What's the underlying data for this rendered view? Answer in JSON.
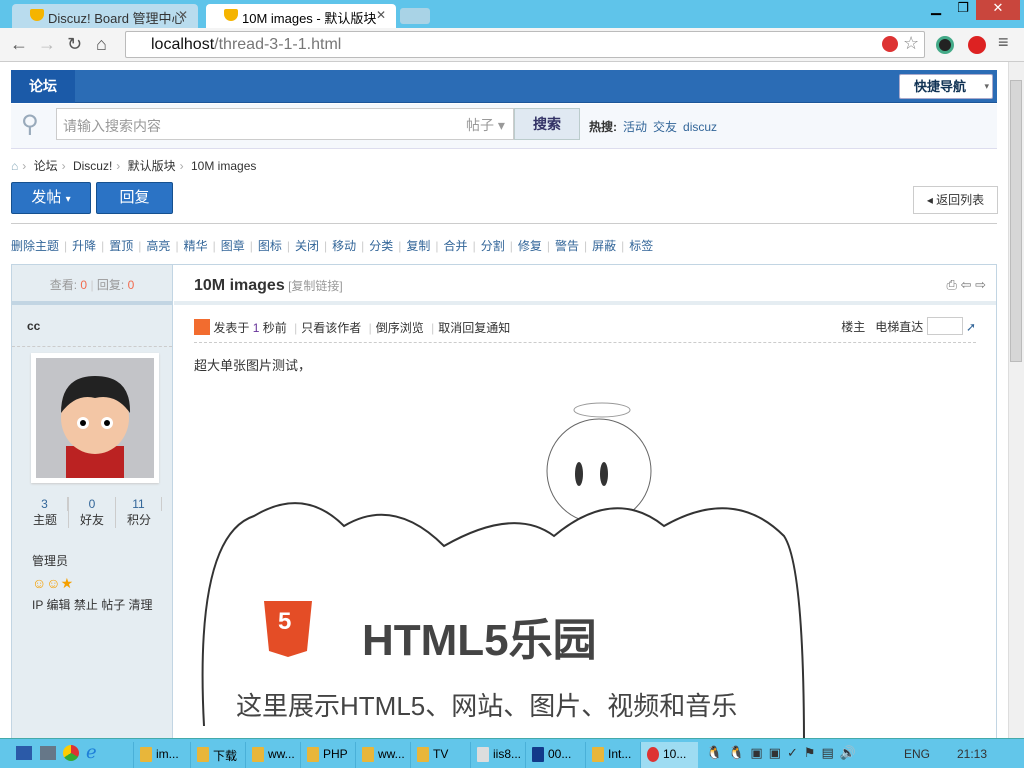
{
  "browser": {
    "tabs": [
      {
        "title": "Discuz! Board 管理中心",
        "active": false
      },
      {
        "title": "10M images - 默认版块",
        "active": true
      }
    ],
    "url_host": "localhost",
    "url_path": "/thread-3-1-1.html",
    "window_buttons": [
      "minimize",
      "restore",
      "close"
    ]
  },
  "nav": {
    "home": "论坛",
    "quick_nav": "快捷导航"
  },
  "search": {
    "placeholder": "请输入搜索内容",
    "type": "帖子",
    "button": "搜索",
    "hot_label": "热搜:",
    "hot": [
      "活动",
      "交友",
      "discuz"
    ]
  },
  "breadcrumb": [
    "论坛",
    "Discuz!",
    "默认版块",
    "10M images"
  ],
  "actions": {
    "post": "发帖",
    "reply": "回复",
    "back": "返回列表"
  },
  "mod_actions": [
    "删除主题",
    "升降",
    "置顶",
    "高亮",
    "精华",
    "图章",
    "图标",
    "关闭",
    "移动",
    "分类",
    "复制",
    "合并",
    "分割",
    "修复",
    "警告",
    "屏蔽",
    "标签"
  ],
  "thread": {
    "views_label": "查看:",
    "views": "0",
    "replies_label": "回复:",
    "replies": "0",
    "title": "10M images",
    "copy_link": "[复制链接]"
  },
  "author": {
    "name": "cc",
    "counts": [
      {
        "value": "3",
        "label": "主题"
      },
      {
        "value": "0",
        "label": "好友"
      },
      {
        "value": "11",
        "label": "积分"
      }
    ],
    "group": "管理员",
    "admin_links": [
      "IP",
      "编辑",
      "禁止",
      "帖子",
      "清理"
    ]
  },
  "post": {
    "posted_prefix": "发表于",
    "posted_num": "1",
    "posted_suffix": "秒前",
    "links": [
      "只看该作者",
      "倒序浏览",
      "取消回复通知"
    ],
    "floor": "楼主",
    "jump": "电梯直达",
    "text": "超大单张图片测试，",
    "image_title": "HTML5乐园",
    "image_subtitle": "这里展示HTML5、网站、图片、视频和音乐",
    "image_badge": "5"
  },
  "taskbar": {
    "items": [
      "im...",
      "下载",
      "ww...",
      "PHP",
      "ww...",
      "TV",
      "iis8...",
      "00...",
      "Int...",
      "10..."
    ],
    "lang": "ENG",
    "time": "21:13"
  }
}
